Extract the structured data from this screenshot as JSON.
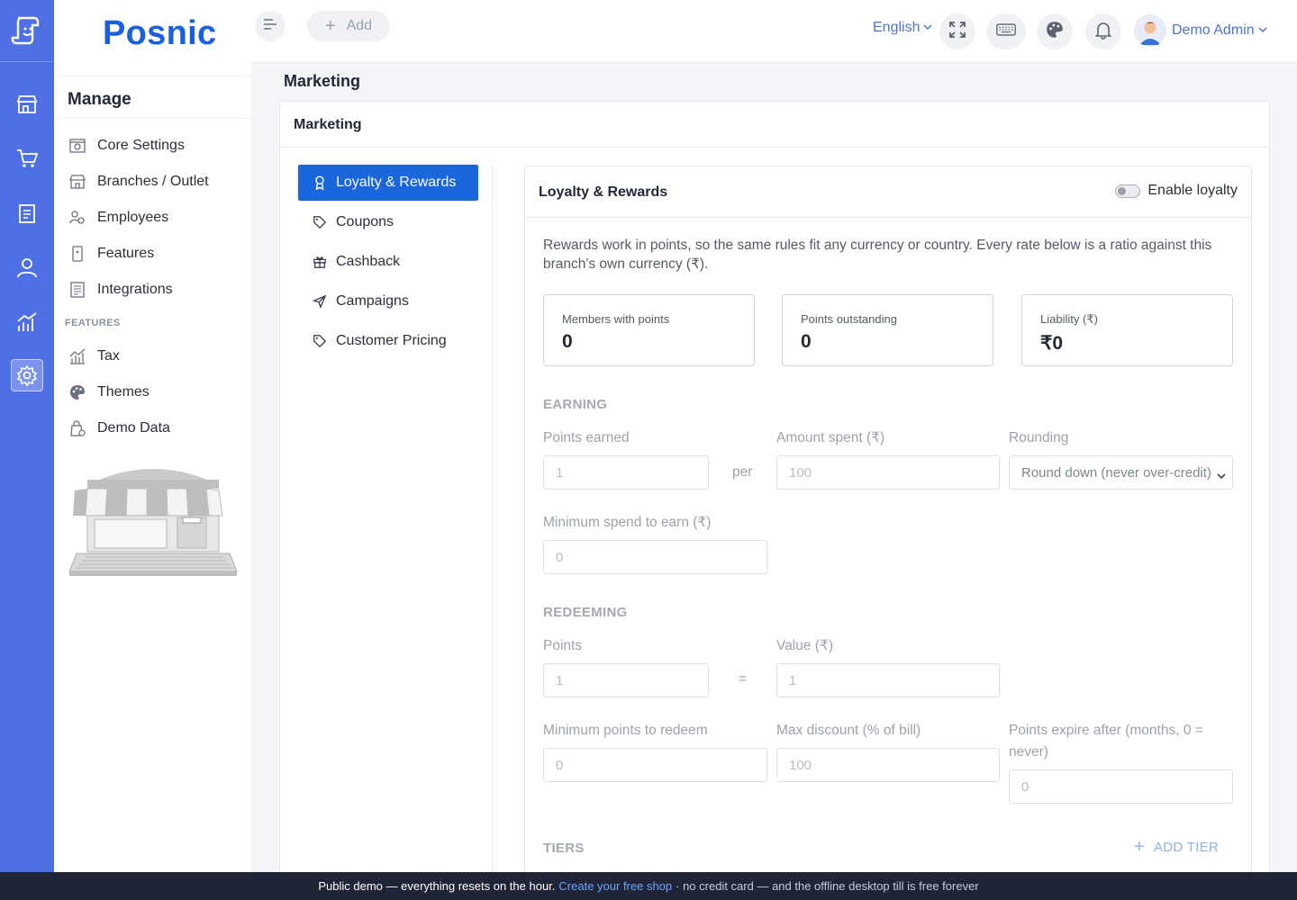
{
  "brand": {
    "name": "Posnic",
    "primary": "#1a66dd",
    "rail": "#4f6fe5"
  },
  "rail": {
    "icons": [
      "logo-icon",
      "store-icon",
      "cart-icon",
      "clipboard-icon",
      "user-icon",
      "analytics-icon",
      "settings-icon"
    ]
  },
  "sidebar": {
    "heading": "Manage",
    "items": [
      {
        "label": "Core Settings",
        "icon": "core-settings-icon"
      },
      {
        "label": "Branches / Outlet",
        "icon": "branch-icon"
      },
      {
        "label": "Employees",
        "icon": "employees-icon"
      },
      {
        "label": "Features",
        "icon": "features-icon"
      },
      {
        "label": "Integrations",
        "icon": "integrations-icon"
      }
    ],
    "section_label": "FEATURES",
    "feature_items": [
      {
        "label": "Tax",
        "icon": "tax-icon"
      },
      {
        "label": "Themes",
        "icon": "palette-icon"
      },
      {
        "label": "Demo Data",
        "icon": "demo-data-icon"
      }
    ]
  },
  "topbar": {
    "add_label": "Add",
    "language": "English",
    "user_name": "Demo Admin"
  },
  "page": {
    "title": "Marketing",
    "card_title": "Marketing"
  },
  "tabs": [
    {
      "label": "Loyalty & Rewards",
      "icon": "award-icon",
      "active": true
    },
    {
      "label": "Coupons",
      "icon": "tag-icon"
    },
    {
      "label": "Cashback",
      "icon": "gift-icon"
    },
    {
      "label": "Campaigns",
      "icon": "send-icon"
    },
    {
      "label": "Customer Pricing",
      "icon": "tag-icon"
    }
  ],
  "loyalty": {
    "title": "Loyalty & Rewards",
    "toggle_label": "Enable loyalty",
    "enabled": false,
    "intro": "Rewards work in points, so the same rules fit any currency or country. Every rate below is a ratio against this branch's own currency (₹).",
    "stats": [
      {
        "label": "Members with points",
        "value": "0"
      },
      {
        "label": "Points outstanding",
        "value": "0"
      },
      {
        "label": "Liability (₹)",
        "value": "₹0"
      }
    ],
    "earning": {
      "section": "EARNING",
      "points_earned_label": "Points earned",
      "points_earned_value": "1",
      "per_text": "per",
      "amount_spent_label": "Amount spent (₹)",
      "amount_spent_value": "100",
      "rounding_label": "Rounding",
      "rounding_value": "Round down (never over-credit)",
      "min_spend_label": "Minimum spend to earn (₹)",
      "min_spend_value": "0"
    },
    "redeeming": {
      "section": "REDEEMING",
      "points_label": "Points",
      "points_value": "1",
      "equals_text": "=",
      "value_label": "Value (₹)",
      "value_value": "1",
      "min_points_label": "Minimum points to redeem",
      "min_points_value": "0",
      "max_discount_label": "Max discount (% of bill)",
      "max_discount_value": "100",
      "expire_label": "Points expire after (months, 0 = never)",
      "expire_value": "0"
    },
    "tiers": {
      "section": "TIERS",
      "add_label": "ADD TIER"
    }
  },
  "footer": {
    "text_a": "Public demo — everything resets on the hour.",
    "link": "Create your free shop",
    "text_b": "· no credit card — and the offline desktop till is free forever"
  }
}
